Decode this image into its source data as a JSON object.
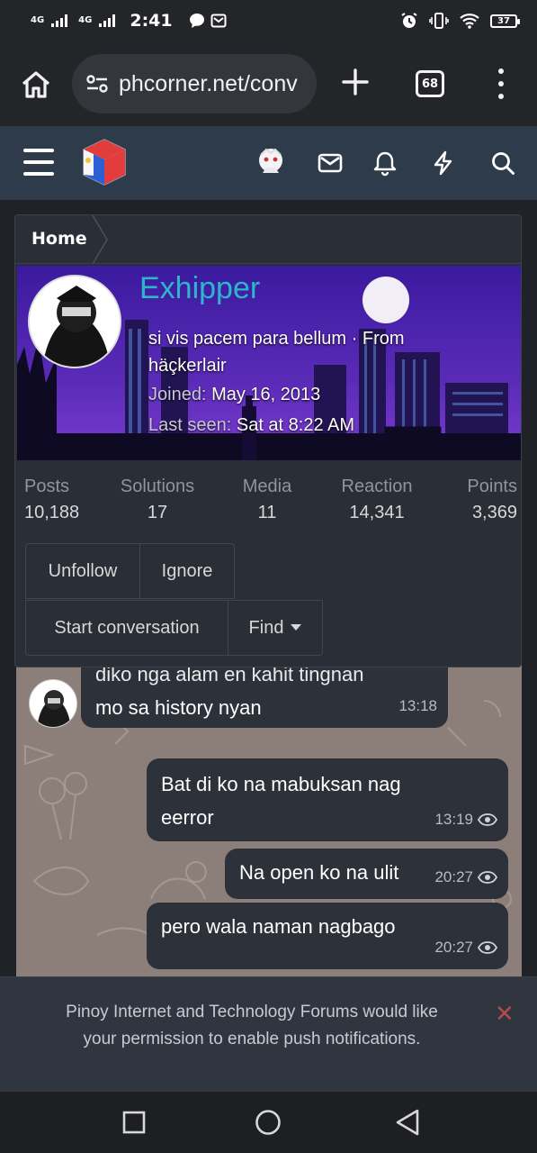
{
  "status_bar": {
    "sim1": "4G",
    "sim2": "4G",
    "time": "2:41",
    "battery": "37",
    "icons": [
      "chat-bubble-icon",
      "mail-icon",
      "alarm-icon",
      "vibrate-icon",
      "wifi-icon",
      "battery-icon"
    ]
  },
  "browser": {
    "url": "phcorner.net/conv",
    "tab_count": "68",
    "icons": [
      "home-icon",
      "site-info-icon",
      "new-tab-icon",
      "more-icon"
    ]
  },
  "forum_header": {
    "icons": [
      "menu-icon",
      "logo-icon",
      "account-avatar-icon",
      "inbox-icon",
      "alerts-icon",
      "whats-new-icon",
      "search-icon"
    ]
  },
  "breadcrumb": {
    "home": "Home"
  },
  "profile": {
    "username": "Exhipper",
    "motto_line1": "si vis pacem para bellum · From",
    "motto_line2": "häçkerlair",
    "joined_label": "Joined:",
    "joined_value": "May 16, 2013",
    "last_seen_label": "Last seen:",
    "last_seen_value": "Sat at 8:22 AM",
    "stats": [
      {
        "label": "Posts",
        "value": "10,188"
      },
      {
        "label": "Solutions",
        "value": "17"
      },
      {
        "label": "Media",
        "value": "11"
      },
      {
        "label": "Reaction",
        "value": "14,341"
      },
      {
        "label": "Points",
        "value": "3,369"
      }
    ],
    "buttons": {
      "unfollow": "Unfollow",
      "ignore": "Ignore",
      "start_conversation": "Start conversation",
      "find": "Find"
    },
    "colors": {
      "username": "#2bb7c9",
      "banner_bg": "#4a27a8"
    }
  },
  "chat": {
    "messages": [
      {
        "side": "left",
        "line1": "diko nga alam en kahit tingnan",
        "line2": "mo sa history nyan",
        "time": "13:18"
      },
      {
        "side": "right",
        "line1": "Bat di ko na mabuksan nag",
        "line2": "eerror",
        "time": "13:19"
      },
      {
        "side": "right",
        "line1": "Na open ko na ulit",
        "time": "20:27"
      },
      {
        "side": "right",
        "line1": "pero wala naman nagbago",
        "time": "20:27"
      }
    ]
  },
  "push_notice": {
    "line1": "Pinoy Internet and Technology Forums would like",
    "line2": "your permission to enable push notifications.",
    "close": "✕"
  },
  "android_nav": {
    "icons": [
      "recents-icon",
      "home-circle-icon",
      "back-icon"
    ]
  }
}
